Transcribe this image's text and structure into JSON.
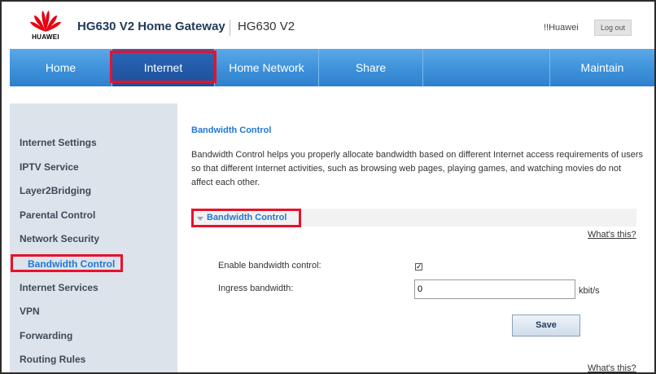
{
  "header": {
    "brand": "HUAWEI",
    "title": "HG630 V2 Home Gateway",
    "model": "HG630 V2",
    "user": "!!Huawei",
    "logout_label": "Log out"
  },
  "nav": {
    "items": [
      {
        "label": "Home"
      },
      {
        "label": "Internet"
      },
      {
        "label": "Home Network"
      },
      {
        "label": "Share"
      },
      {
        "label": ""
      },
      {
        "label": "Maintain"
      }
    ],
    "active": "Internet"
  },
  "sidebar": {
    "items": [
      {
        "label": "Internet Settings"
      },
      {
        "label": "IPTV Service"
      },
      {
        "label": "Layer2Bridging"
      },
      {
        "label": "Parental Control"
      },
      {
        "label": "Network Security"
      },
      {
        "label": "Bandwidth Control"
      },
      {
        "label": "Internet Services"
      },
      {
        "label": "VPN"
      },
      {
        "label": "Forwarding"
      },
      {
        "label": "Routing Rules"
      }
    ],
    "active": "Bandwidth Control"
  },
  "main": {
    "section_title": "Bandwidth Control",
    "description": "Bandwidth Control helps you properly allocate bandwidth based on different Internet access requirements of users so that different Internet activities, such as browsing web pages, playing games, and watching movies do not affect each other.",
    "panel_title": "Bandwidth Control",
    "whats_this_label": "What's this?",
    "enable_label": "Enable bandwidth control:",
    "enable_checked": true,
    "check_mark": "✓",
    "ingress_label": "Ingress bandwidth:",
    "ingress_value": "0",
    "ingress_unit": "kbit/s",
    "save_label": "Save"
  },
  "colors": {
    "nav_blue": "#3b8fd8",
    "nav_active": "#1d4f98",
    "accent_link": "#2277d2",
    "highlight_red": "#e8112d",
    "sidebar_bg": "#dde3ea",
    "brand_red": "#e60012"
  }
}
